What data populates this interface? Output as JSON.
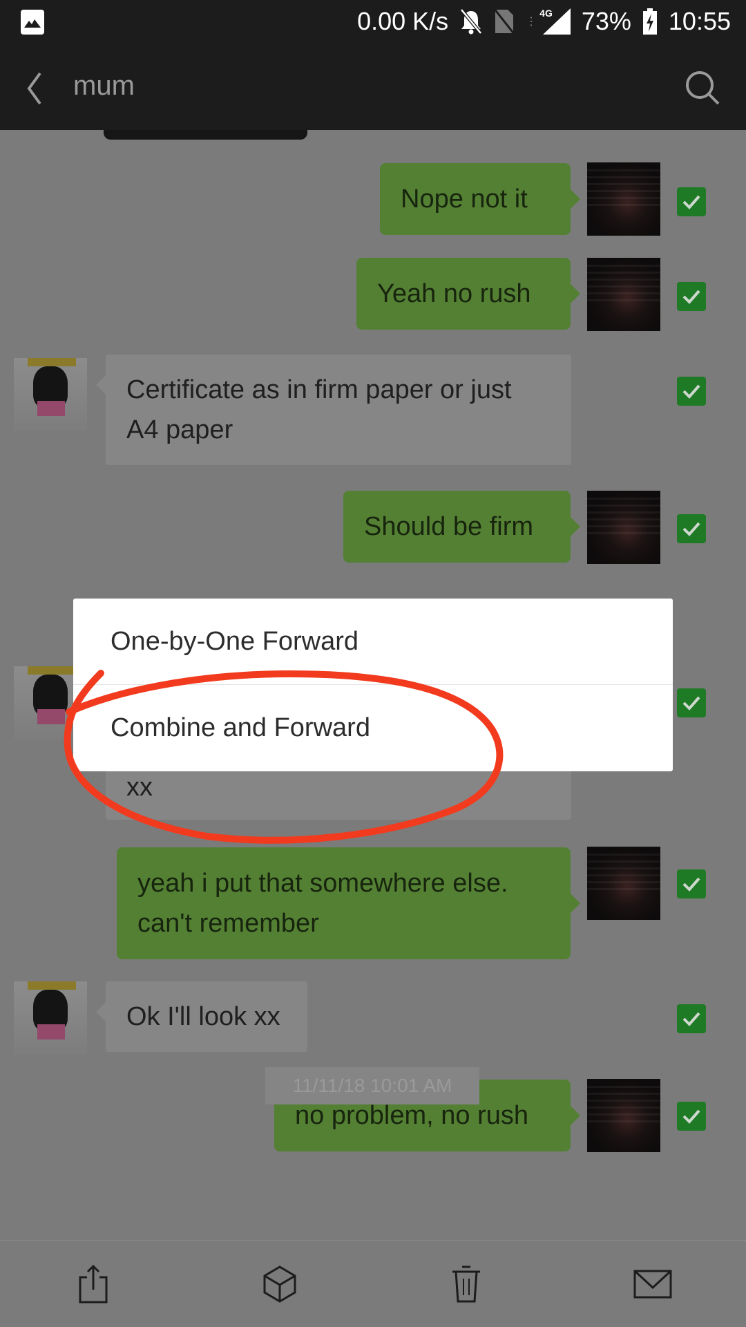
{
  "status_bar": {
    "net_speed": "0.00 K/s",
    "network_type": "4G",
    "battery": "73%",
    "time": "10:55",
    "icons": [
      "gallery-icon",
      "bell-off-icon",
      "no-sim-icon",
      "signal-icon",
      "battery-charging-icon"
    ]
  },
  "app_bar": {
    "back_icon": "chevron-left-icon",
    "title": "mum",
    "search_icon": "search-icon"
  },
  "messages": [
    {
      "sender": "me",
      "lines": [
        "Nope not it"
      ],
      "selected": true
    },
    {
      "sender": "me",
      "lines": [
        "Yeah no rush"
      ],
      "selected": true
    },
    {
      "sender": "them",
      "lines": [
        "Certificate as in firm paper or just",
        "A4 paper"
      ],
      "selected": true
    },
    {
      "sender": "me",
      "lines": [
        "Should be firm"
      ],
      "selected": true
    },
    {
      "sender": "them",
      "lines": [
        "xx"
      ],
      "selected": true,
      "partially_hidden": true
    },
    {
      "sender": "me",
      "lines": [
        "yeah i put that somewhere else.",
        "can't remember"
      ],
      "selected": true
    },
    {
      "sender": "them",
      "lines": [
        "Ok I'll look xx"
      ],
      "selected": true
    },
    {
      "sender": "me",
      "lines": [
        "no problem, no rush"
      ],
      "selected": true
    }
  ],
  "timestamp": "11/11/18 10:01 AM",
  "forward_menu": {
    "items": [
      {
        "label": "One-by-One Forward"
      },
      {
        "label": "Combine and Forward",
        "highlighted_by_annotation": true
      }
    ]
  },
  "toolbar": {
    "items": [
      {
        "name": "forward",
        "icon": "share-icon"
      },
      {
        "name": "favorite",
        "icon": "cube-icon"
      },
      {
        "name": "delete",
        "icon": "trash-icon"
      },
      {
        "name": "email",
        "icon": "mail-icon"
      }
    ]
  },
  "colors": {
    "my_bubble": "#548034",
    "their_bubble": "#868686",
    "check": "#1f7a25",
    "annotation": "#f23b1e",
    "bar_bg": "#1c1c1c"
  }
}
